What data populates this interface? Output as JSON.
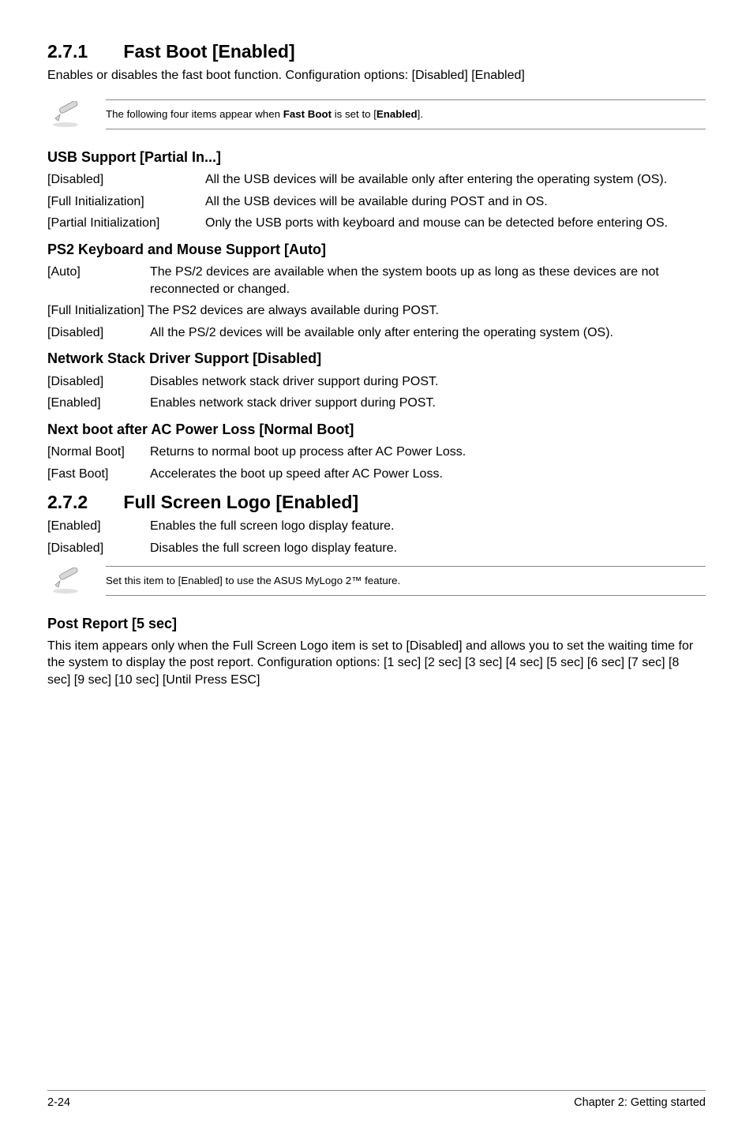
{
  "sec271": {
    "heading_num": "2.7.1",
    "heading_title": "Fast Boot [Enabled]",
    "intro": "Enables or disables the fast boot function. Configuration options: [Disabled] [Enabled]",
    "note_prefix": "The following four items appear when ",
    "note_bold1": "Fast Boot",
    "note_mid": " is set to [",
    "note_bold2": "Enabled",
    "note_suffix": "]."
  },
  "usb": {
    "heading": "USB Support [Partial In...]",
    "rows": [
      {
        "term": "[Disabled]",
        "desc": "All the USB devices will be available only after entering the operating system (OS)."
      },
      {
        "term": "[Full Initialization]",
        "desc": "All the USB devices will be available during POST and in OS."
      },
      {
        "term": "[Partial Initialization]",
        "desc": "Only the USB ports with keyboard and mouse can be detected before entering OS."
      }
    ]
  },
  "ps2": {
    "heading": "PS2 Keyboard and Mouse Support [Auto]",
    "rows": [
      {
        "term": "[Auto]",
        "desc": "The PS/2 devices are available when the system boots up as long as these devices are not reconnected or changed."
      },
      {
        "term": "[Full Initialization]",
        "desc": "The PS2 devices are always available during POST.",
        "inline_offset": true
      },
      {
        "term": "[Disabled]",
        "desc": "All the PS/2 devices will be available only after entering the operating system (OS)."
      }
    ]
  },
  "net": {
    "heading": "Network Stack Driver Support [Disabled]",
    "rows": [
      {
        "term": "[Disabled]",
        "desc": "Disables network stack driver support during POST."
      },
      {
        "term": "[Enabled]",
        "desc": "Enables network stack driver support during POST."
      }
    ]
  },
  "nextboot": {
    "heading": "Next boot after AC Power Loss [Normal Boot]",
    "rows": [
      {
        "term": "[Normal Boot]",
        "desc": "Returns to normal boot up process after AC Power Loss."
      },
      {
        "term": "[Fast Boot]",
        "desc": "Accelerates the boot up speed after AC Power Loss."
      }
    ]
  },
  "sec272": {
    "heading_num": "2.7.2",
    "heading_title": "Full Screen Logo [Enabled]",
    "rows": [
      {
        "term": "[Enabled]",
        "desc": "Enables the full screen logo display feature."
      },
      {
        "term": "[Disabled]",
        "desc": "Disables the full screen logo display feature."
      }
    ],
    "note": "Set this item to [Enabled] to use the ASUS MyLogo 2™ feature."
  },
  "post": {
    "heading": "Post Report [5 sec]",
    "para": "This item appears only when the Full Screen Logo item is set to [Disabled] and allows you to set the waiting time for the system to display the post report. Configuration options: [1 sec] [2 sec] [3 sec] [4 sec] [5 sec] [6 sec] [7 sec] [8 sec] [9 sec] [10 sec] [Until Press ESC]"
  },
  "footer": {
    "left": "2-24",
    "right": "Chapter 2: Getting started"
  }
}
